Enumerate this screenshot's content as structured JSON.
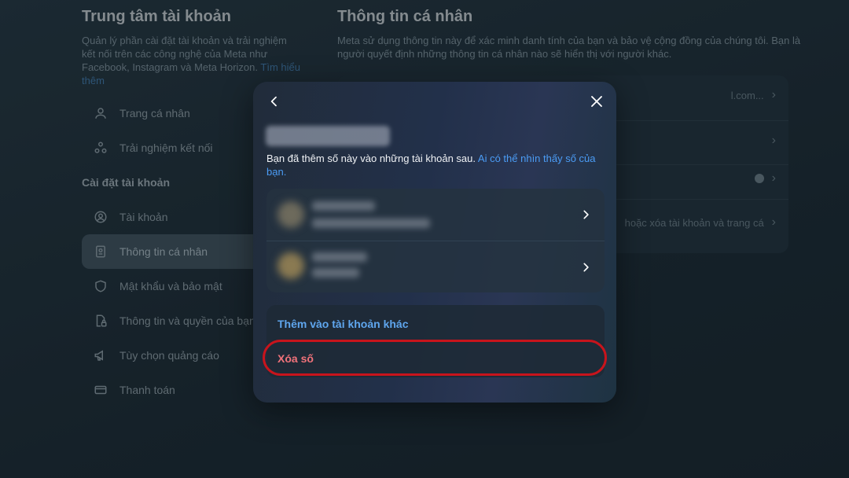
{
  "accounts_center": {
    "title": "Trung tâm tài khoản",
    "description": "Quản lý phần cài đặt tài khoản và trải nghiệm kết nối trên các công nghệ của Meta như Facebook, Instagram và Meta Horizon.",
    "learn_more": "Tìm hiểu thêm",
    "nav_top": [
      {
        "label": "Trang cá nhân",
        "icon": "person-icon"
      },
      {
        "label": "Trải nghiệm kết nối",
        "icon": "connected-icon"
      }
    ],
    "settings_heading": "Cài đặt tài khoản",
    "nav_settings": [
      {
        "label": "Tài khoản",
        "icon": "account-circle-icon"
      },
      {
        "label": "Thông tin cá nhân",
        "icon": "id-card-icon",
        "active": true
      },
      {
        "label": "Mật khẩu và bảo mật",
        "icon": "shield-icon"
      },
      {
        "label": "Thông tin và quyền của bạn",
        "icon": "document-lock-icon"
      },
      {
        "label": "Tùy chọn quảng cáo",
        "icon": "megaphone-icon"
      },
      {
        "label": "Thanh toán",
        "icon": "credit-card-icon"
      }
    ]
  },
  "personal_info": {
    "title": "Thông tin cá nhân",
    "description": "Meta sử dụng thông tin này để xác minh danh tính của bạn và bảo vệ cộng đồng của chúng tôi. Bạn là người quyết định những thông tin cá nhân nào sẽ hiển thị với người khác.",
    "row_email_partial": "l.com...",
    "row_delete_partial": "hoặc xóa tài khoản và trang cá"
  },
  "modal": {
    "intro_text": "Bạn đã thêm số này vào những tài khoản sau.",
    "intro_link": "Ai có thể nhìn thấy số của bạn.",
    "add_to_other_account": "Thêm vào tài khoản khác",
    "delete_number": "Xóa số"
  },
  "colors": {
    "link": "#4b9cf5",
    "danger": "#f0727a",
    "highlight_ring": "#c8141c"
  }
}
